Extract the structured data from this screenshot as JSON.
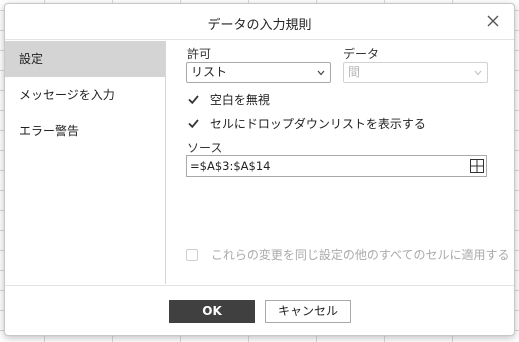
{
  "dialog": {
    "title": "データの入力規則",
    "close_icon": "close-icon"
  },
  "sidebar": {
    "items": [
      {
        "label": "設定",
        "active": true
      },
      {
        "label": "メッセージを入力",
        "active": false
      },
      {
        "label": "エラー警告",
        "active": false
      }
    ]
  },
  "settings": {
    "allow_label": "許可",
    "allow_value": "リスト",
    "data_label": "データ",
    "data_value": "間",
    "ignore_blank_label": "空白を無視",
    "ignore_blank_checked": true,
    "show_dropdown_label": "セルにドロップダウンリストを表示する",
    "show_dropdown_checked": true,
    "source_label": "ソース",
    "source_value": "=$A$3:$A$14",
    "range_icon": "grid-icon",
    "apply_all_label": "これらの変更を同じ設定の他のすべてのセルに適用する",
    "apply_all_checked": false
  },
  "footer": {
    "ok_label": "OK",
    "cancel_label": "キャンセル"
  },
  "colors": {
    "accent_dark": "#404040",
    "sidebar_active": "#d4d4d4"
  }
}
